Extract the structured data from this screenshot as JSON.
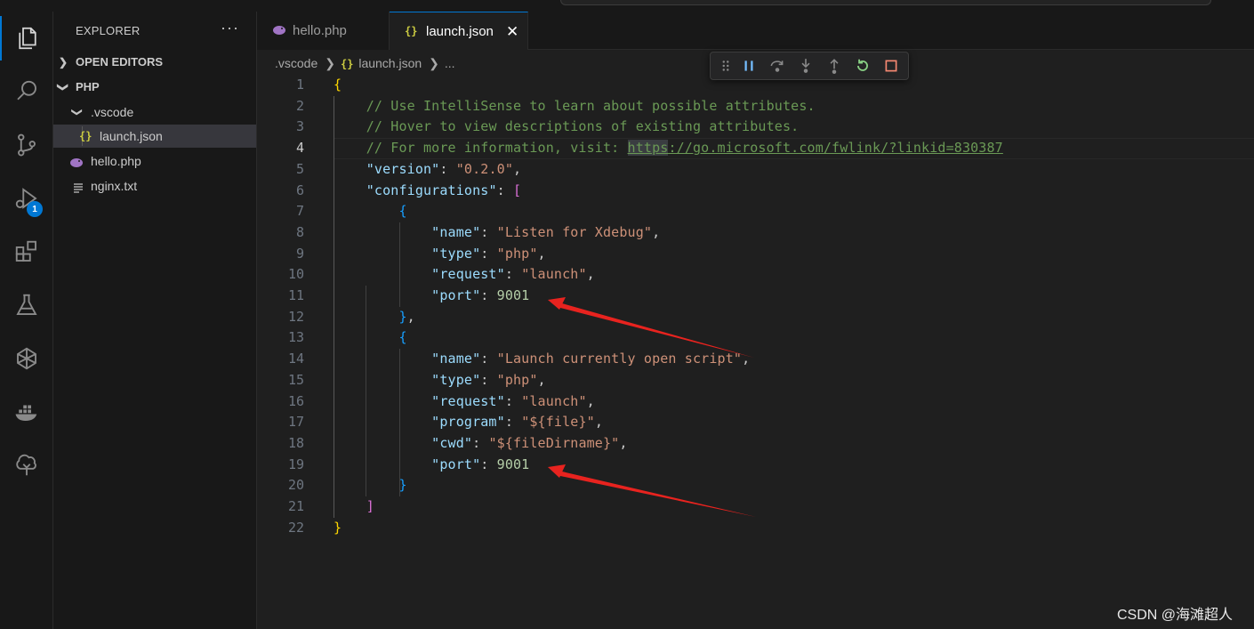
{
  "sidebar": {
    "title": "EXPLORER",
    "more": "···",
    "open_editors": "OPEN EDITORS",
    "folder": "PHP",
    "subfolder": ".vscode",
    "files": {
      "launch_json": "launch.json",
      "hello_php": "hello.php",
      "nginx_txt": "nginx.txt"
    }
  },
  "activity": {
    "debug_badge": "1"
  },
  "tabs": [
    {
      "label": "hello.php"
    },
    {
      "label": "launch.json"
    }
  ],
  "breadcrumb": {
    "folder": ".vscode",
    "file": "launch.json",
    "more": "..."
  },
  "editor": {
    "current_line": 4,
    "line_numbers": [
      "1",
      "2",
      "3",
      "4",
      "5",
      "6",
      "7",
      "8",
      "9",
      "10",
      "11",
      "12",
      "13",
      "14",
      "15",
      "16",
      "17",
      "18",
      "19",
      "20",
      "21",
      "22"
    ],
    "comments": [
      "// Use IntelliSense to learn about possible attributes.",
      "// Hover to view descriptions of existing attributes.",
      "// For more information, visit: "
    ],
    "url_highlight": "https",
    "url_rest": "://go.microsoft.com/fwlink/?linkid=830387",
    "version_key": "\"version\"",
    "version_val": "\"0.2.0\"",
    "configurations_key": "\"configurations\"",
    "cfg1": {
      "name_key": "\"name\"",
      "name_val": "\"Listen for Xdebug\"",
      "type_key": "\"type\"",
      "type_val": "\"php\"",
      "request_key": "\"request\"",
      "request_val": "\"launch\"",
      "port_key": "\"port\"",
      "port_val": "9001"
    },
    "cfg2": {
      "name_key": "\"name\"",
      "name_val": "\"Launch currently open script\"",
      "type_key": "\"type\"",
      "type_val": "\"php\"",
      "request_key": "\"request\"",
      "request_val": "\"launch\"",
      "program_key": "\"program\"",
      "program_val": "\"${file}\"",
      "cwd_key": "\"cwd\"",
      "cwd_val": "\"${fileDirname}\"",
      "port_key": "\"port\"",
      "port_val": "9001"
    }
  },
  "colors": {
    "accent": "#0078d4",
    "annotation_arrow": "#e8231f",
    "json_key": "#9cdcfe",
    "json_string": "#ce9178",
    "json_number": "#b5cea8",
    "comment": "#6a9955"
  },
  "watermark": "CSDN @海滩超人"
}
